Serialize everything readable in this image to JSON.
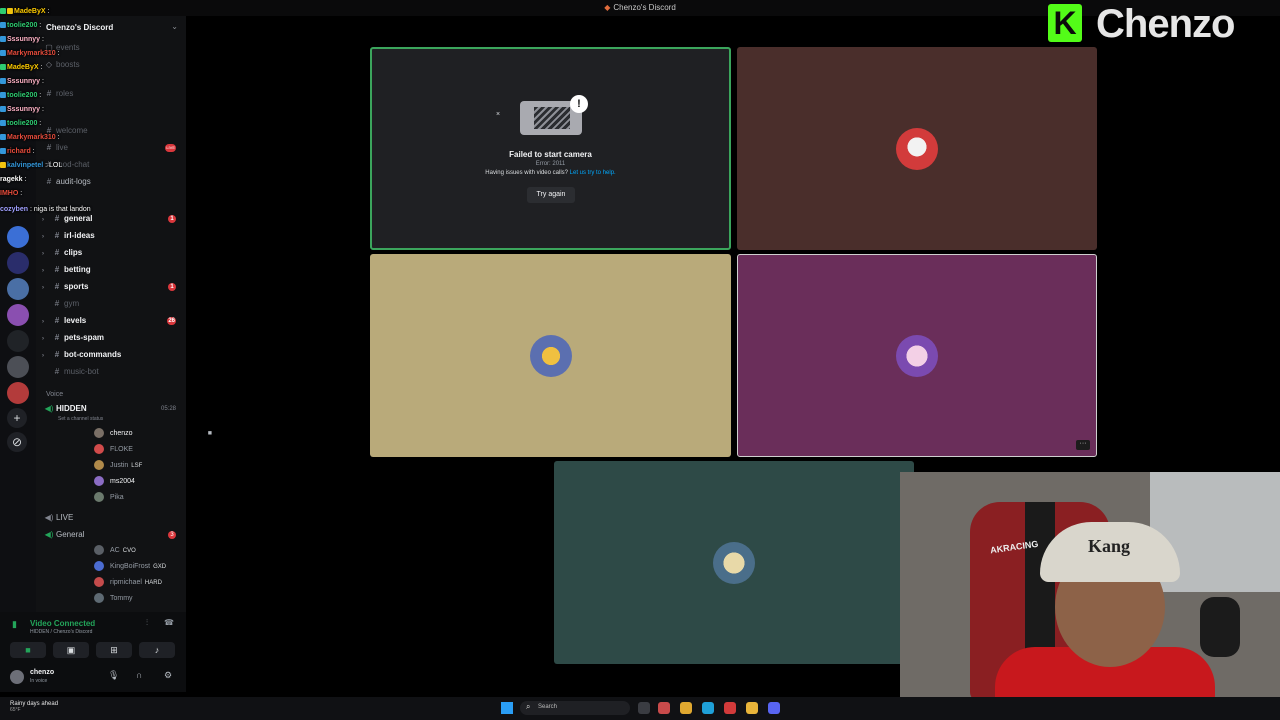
{
  "window": {
    "title": "Chenzo's Discord"
  },
  "brand": {
    "name": "Chenzo",
    "accent": "#53fc18"
  },
  "server": {
    "name": "Chenzo's Discord",
    "channels": [
      {
        "name": "events",
        "state": "muted"
      },
      {
        "name": "boosts",
        "state": "muted"
      },
      {
        "name": "roles",
        "state": "muted"
      },
      {
        "name": "welcome",
        "state": "muted"
      },
      {
        "name": "live",
        "state": "muted",
        "badge": "LIVE"
      },
      {
        "name": "mod-chat",
        "state": "muted"
      },
      {
        "name": "audit-logs",
        "state": "normal"
      },
      {
        "name": "general",
        "state": "bright",
        "badge": "1"
      },
      {
        "name": "irl-ideas",
        "state": "bright"
      },
      {
        "name": "clips",
        "state": "bright"
      },
      {
        "name": "betting",
        "state": "bright"
      },
      {
        "name": "sports",
        "state": "bright",
        "badge": "1"
      },
      {
        "name": "gym",
        "state": "muted"
      },
      {
        "name": "levels",
        "state": "bright",
        "badge": "26"
      },
      {
        "name": "pets-spam",
        "state": "bright"
      },
      {
        "name": "bot-commands",
        "state": "bright"
      },
      {
        "name": "music-bot",
        "state": "muted"
      }
    ],
    "voice_category": "Voice",
    "voice_channels": {
      "hidden": {
        "name": "HIDDEN",
        "count": "05:28",
        "status": "Set a channel status"
      },
      "live": {
        "name": "LIVE"
      },
      "general": {
        "name": "General",
        "badge": "3"
      }
    },
    "hidden_members": [
      {
        "name": "chenzo",
        "tag": "",
        "active": true,
        "color": "#7a6f66"
      },
      {
        "name": "FLOKE",
        "tag": "",
        "active": false,
        "color": "#d14b4b"
      },
      {
        "name": "Justin",
        "tag": "LSF",
        "active": false,
        "color": "#b08a4a"
      },
      {
        "name": "ms2004",
        "tag": "",
        "active": true,
        "color": "#8b6cc4"
      },
      {
        "name": "Pika",
        "tag": "",
        "active": false,
        "color": "#6b7a6d"
      }
    ],
    "general_members": [
      {
        "name": "AC",
        "tag": "CVO",
        "color": "#5a5f66"
      },
      {
        "name": "KingBoiFrost",
        "tag": "GXD",
        "color": "#4b6cd1"
      },
      {
        "name": "ripmichael",
        "tag": "HARD",
        "color": "#c44b4b"
      },
      {
        "name": "Tommy",
        "tag": "",
        "color": "#5e6a73"
      }
    ]
  },
  "chat": [
    {
      "user": "MadeByX",
      "text": "",
      "color": "#ffcc00"
    },
    {
      "user": "toolie200",
      "text": "",
      "color": "#2ecc71"
    },
    {
      "user": "Sssunnyy",
      "text": "",
      "color": "#ffb3c7"
    },
    {
      "user": "Markymark310",
      "text": "",
      "color": "#e74c3c"
    },
    {
      "user": "MadeByX",
      "text": "",
      "color": "#ffcc00"
    },
    {
      "user": "Sssunnyy",
      "text": "",
      "color": "#ffb3c7"
    },
    {
      "user": "toolie200",
      "text": "",
      "color": "#2ecc71"
    },
    {
      "user": "Sssunnyy",
      "text": "",
      "color": "#ffb3c7"
    },
    {
      "user": "toolie200",
      "text": "",
      "color": "#2ecc71"
    },
    {
      "user": "Markymark310",
      "text": "",
      "color": "#e74c3c"
    },
    {
      "user": "richard",
      "text": "",
      "color": "#e74c3c"
    },
    {
      "user": "kalvinpetel",
      "text": "LOL",
      "color": "#3498db"
    },
    {
      "user": "ragekk",
      "text": "",
      "color": "#ffffff"
    },
    {
      "user": "IMHO",
      "text": "",
      "color": "#e74c3c"
    },
    {
      "user": "cozyben",
      "text": "niga is that landon",
      "color": "#a0a0ff"
    }
  ],
  "voice_panel": {
    "status": "Video Connected",
    "sub": "HIDDEN / Chenzo's Discord"
  },
  "user_panel": {
    "name": "chenzo",
    "status": "In voice"
  },
  "video": {
    "error_title": "Failed to start camera",
    "error_code": "Error: 2011",
    "help_text": "Having issues with video calls?",
    "help_link": "Let us try to help.",
    "retry_label": "Try again",
    "tiles": [
      {
        "bg": "#4a2e2b"
      },
      {
        "bg": "#b9aa7a"
      },
      {
        "bg": "#6a2e5a"
      },
      {
        "bg": "#2e4a47"
      }
    ]
  },
  "webcam": {
    "hat_text": "Kang",
    "chair_text": "AKRACING"
  },
  "taskbar": {
    "weather": "Rainy days ahead",
    "temp": "65°F",
    "search_placeholder": "Search"
  }
}
